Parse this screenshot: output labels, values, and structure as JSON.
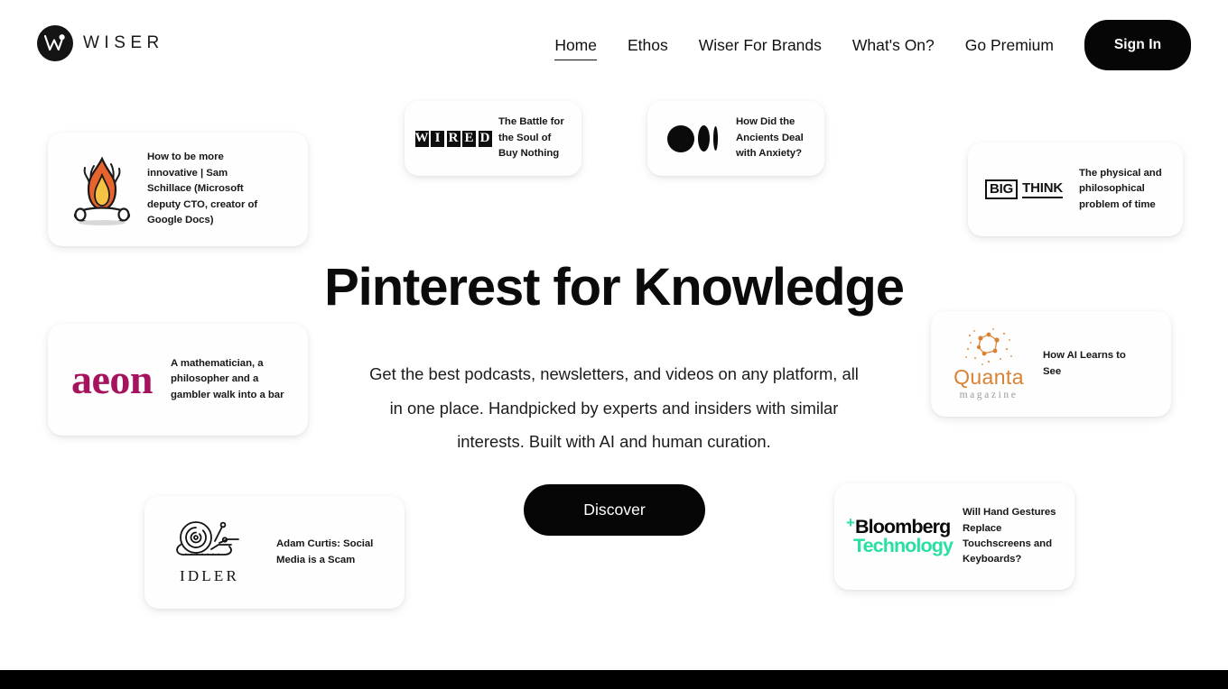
{
  "brand": {
    "name": "WISER",
    "mark_icon": "wiser-w-logo-icon"
  },
  "nav": {
    "links": [
      {
        "label": "Home",
        "active": true
      },
      {
        "label": "Ethos",
        "active": false
      },
      {
        "label": "Wiser For Brands",
        "active": false
      },
      {
        "label": "What's On?",
        "active": false
      },
      {
        "label": "Go Premium",
        "active": false
      }
    ],
    "signin_label": "Sign In"
  },
  "hero": {
    "title": "Pinterest for Knowledge",
    "subtitle": "Get the best podcasts, newsletters, and videos on any platform, all in one place. Handpicked by experts and insiders with similar interests. Built with AI and human curation.",
    "cta_label": "Discover"
  },
  "cards": {
    "campfire": {
      "logo_icon": "campfire-illustration-icon",
      "text": "How to be more innovative | Sam Schillace (Microsoft deputy CTO, creator of Google Docs)"
    },
    "wired": {
      "logo_icon": "wired-logo-icon",
      "logo_letters": [
        "W",
        "I",
        "R",
        "E",
        "D"
      ],
      "text": "The Battle for the Soul of Buy Nothing"
    },
    "medium": {
      "logo_icon": "medium-logo-icon",
      "text": "How Did the Ancients Deal with Anxiety?"
    },
    "bigthink": {
      "logo_icon": "big-think-logo-icon",
      "logo_word_1": "BIG",
      "logo_word_2": "THINK",
      "text": "The physical and philosophical problem of time"
    },
    "aeon": {
      "logo_icon": "aeon-logo-icon",
      "logo_word": "aeon",
      "text": "A mathematician, a philosopher and a gambler walk into a bar"
    },
    "quanta": {
      "logo_icon": "quanta-constellation-icon",
      "logo_word": "Quanta",
      "logo_sub": "magazine",
      "text": "How AI Learns to See"
    },
    "idler": {
      "logo_icon": "idler-snail-icon",
      "logo_word": "IDLER",
      "text": "Adam Curtis: Social Media is a Scam"
    },
    "bloomberg": {
      "logo_icon": "bloomberg-technology-logo-icon",
      "logo_plus": "+",
      "logo_word_1": "Bloomberg",
      "logo_word_2": "Technology",
      "text": "Will Hand Gestures Replace Touchscreens and Keyboards?"
    }
  },
  "colors": {
    "black": "#060606",
    "aeon_magenta": "#A5135E",
    "quanta_orange": "#D98234",
    "bloomberg_green": "#27E0A1",
    "flame_orange": "#E8642E",
    "flame_yellow": "#F5A623"
  }
}
